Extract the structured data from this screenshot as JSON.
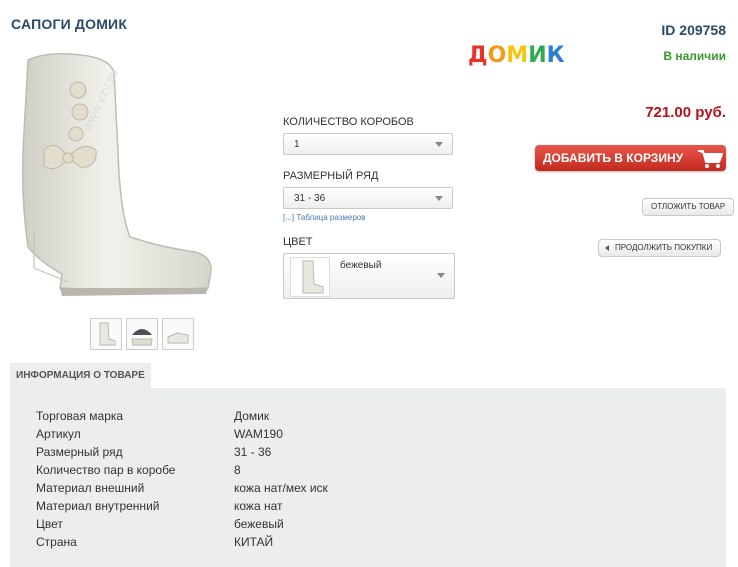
{
  "product": {
    "title": "САПОГИ ДОМИК",
    "id": "ID 209758",
    "brand_letters": [
      {
        "ch": "Д",
        "color": "#e8322a"
      },
      {
        "ch": "О",
        "color": "#f29a1c"
      },
      {
        "ch": "М",
        "color": "#f4c60f"
      },
      {
        "ch": "И",
        "color": "#2fa84f"
      },
      {
        "ch": "К",
        "color": "#2a7fd1"
      }
    ],
    "stock": "В наличии",
    "price": "721.00 руб."
  },
  "options": {
    "boxes_label": "КОЛИЧЕСТВО КОРОБОВ",
    "boxes_value": "1",
    "size_label": "РАЗМЕРНЫЙ РЯД",
    "size_value": "31 - 36",
    "size_table_link": "[...] Таблица размеров",
    "color_label": "ЦВЕТ",
    "color_value": "бежевый"
  },
  "actions": {
    "add_to_cart": "ДОБАВИТЬ В КОРЗИНУ",
    "postpone": "ОТЛОЖИТЬ ТОВАР",
    "continue": "ПРОДОЛЖИТЬ ПОКУПКИ"
  },
  "info": {
    "tab_label": "ИНФОРМАЦИЯ О ТОВАРЕ",
    "rows": [
      {
        "key": "Торговая марка",
        "value": "Домик"
      },
      {
        "key": "Артикул",
        "value": "WAM190"
      },
      {
        "key": "Размерный ряд",
        "value": "31 - 36"
      },
      {
        "key": "Количество пар в коробе",
        "value": "8"
      },
      {
        "key": "Материал внешний",
        "value": "кожа нат/мех иск"
      },
      {
        "key": "Материал внутренний",
        "value": "кожа нат"
      },
      {
        "key": "Цвет",
        "value": "бежевый"
      },
      {
        "key": "Страна",
        "value": "КИТАЙ"
      }
    ]
  },
  "watermark": "www.vzv.su",
  "colors": {
    "title": "#2a4a6b",
    "price": "#b5121b",
    "stock": "#3a9a2a",
    "cart_button": "#d23a2e"
  }
}
